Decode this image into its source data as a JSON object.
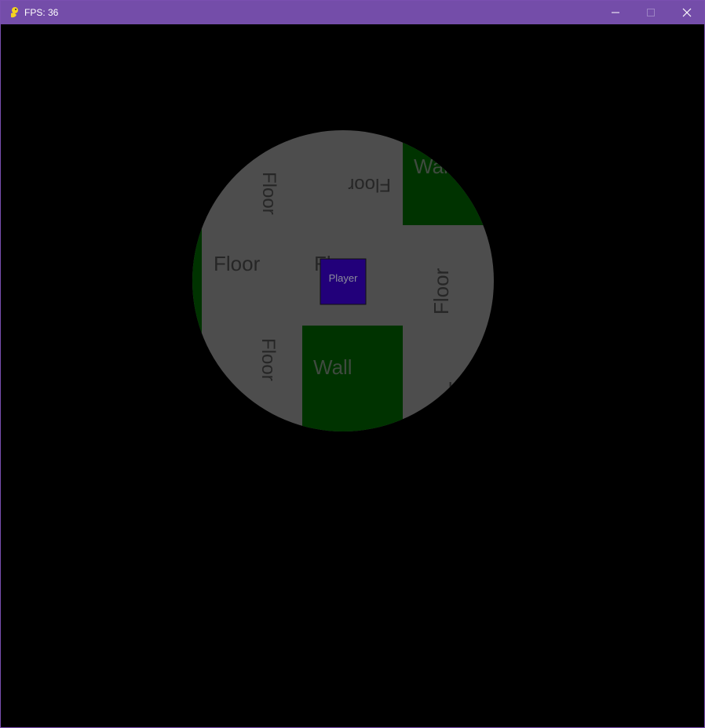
{
  "window": {
    "title": "FPS: 36",
    "icon": "pygame-snake-icon",
    "controls": {
      "minimize": "minimize-icon",
      "maximize": "maximize-icon",
      "close": "close-icon"
    }
  },
  "game": {
    "background_color": "#000000",
    "floor_color": "#4d4d4d",
    "wall_color": "#003300",
    "player_color": "#22007a",
    "label_color_floor": "#262626",
    "label_color_wall": "#3f4a3f",
    "tiles": {
      "floor_top_left": "Floor",
      "floor_top": "Floor",
      "wall_top_right": "Wall",
      "floor_left": "Floor",
      "floor_center": "Floor",
      "floor_right": "Floor",
      "floor_bottom_left": "Floor",
      "wall_bottom": "Wall",
      "floor_bottom_right": "Floor"
    },
    "player": {
      "label": "Player"
    }
  }
}
